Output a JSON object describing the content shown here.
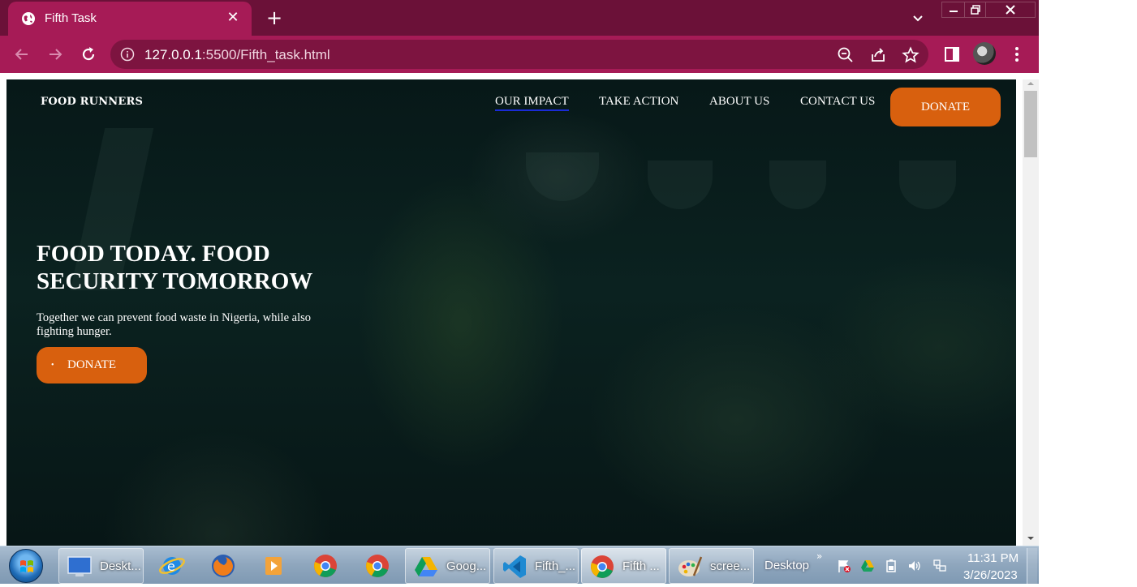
{
  "browser": {
    "tab_title": "Fifth Task",
    "tab_close": "✕",
    "new_tab": "+",
    "url_host": "127.0.0.1",
    "url_rest": ":5500/Fifth_task.html"
  },
  "site": {
    "logo": "FOOD RUNNERS",
    "nav": [
      "OUR IMPACT",
      "TAKE ACTION",
      "ABOUT US",
      "CONTACT US"
    ],
    "donate_top": "DONATE",
    "hero_title": "FOOD TODAY. FOOD SECURITY TOMORROW",
    "hero_sub": "Together we can prevent food waste in Nigeria, while also fighting hunger.",
    "donate_hero": "DONATE",
    "bullet": "•"
  },
  "taskbar": {
    "items": [
      "Deskt...",
      "Goog...",
      "Fifth_...",
      "Fifth ...",
      "scree..."
    ],
    "desktop_label": "Desktop",
    "desktop_chevron": "»",
    "time": "11:31 PM",
    "date": "3/26/2023"
  },
  "colors": {
    "tabstrip": "#6b1138",
    "toolbar": "#a61b56",
    "accent_button": "#d8600e",
    "active_underline": "#1a2bd6"
  }
}
